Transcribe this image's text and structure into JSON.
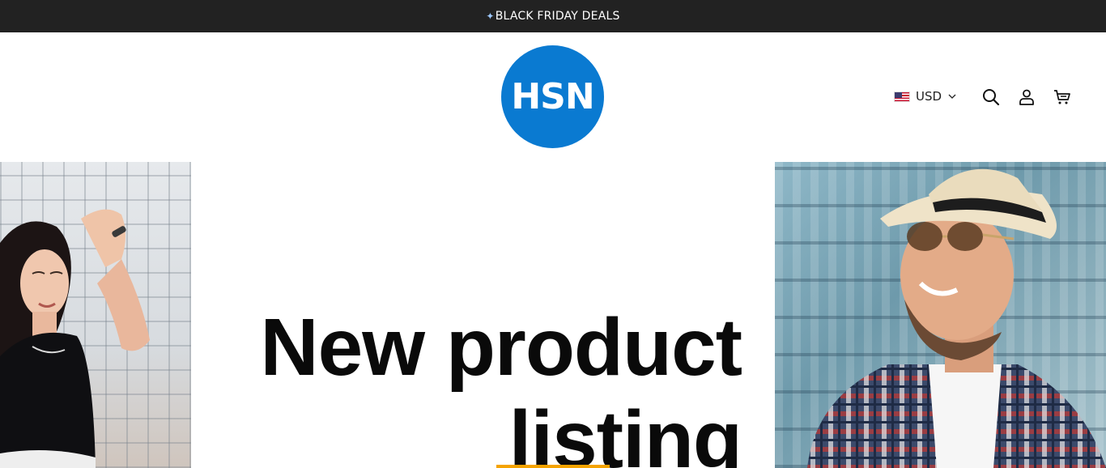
{
  "announcement": {
    "icon": "sparkle-icon",
    "text": "BLACK FRIDAY DEALS"
  },
  "header": {
    "logo_text": "HSN",
    "brand_color": "#0a7ad1",
    "currency": {
      "flag": "us-flag-icon",
      "selected": "USD"
    },
    "icons": [
      "search-icon",
      "account-icon",
      "cart-icon"
    ]
  },
  "hero": {
    "title_line1": "New product",
    "title_line2": "listing",
    "accent_color": "#f5a300"
  }
}
